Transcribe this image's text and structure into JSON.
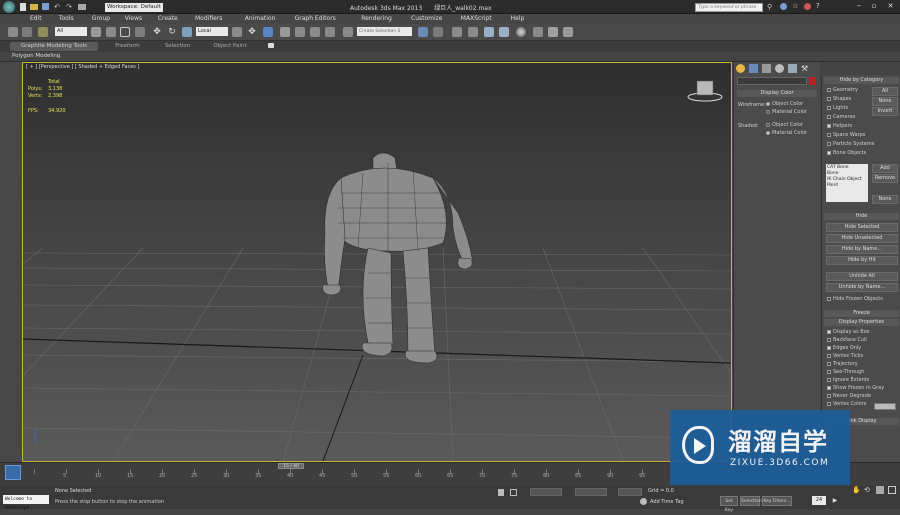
{
  "titlebar": {
    "workspace": "Workspace: Default",
    "app_title": "Autodesk 3ds Max 2013",
    "file": "绿巨人_walk02.max",
    "search_placeholder": "Type a keyword or phrase"
  },
  "menu": [
    "Edit",
    "Tools",
    "Group",
    "Views",
    "Create",
    "Modifiers",
    "Animation",
    "Graph Editors",
    "Rendering",
    "Customize",
    "MAXScript",
    "Help"
  ],
  "toolbar": {
    "selection_filter": "All",
    "ref_coord": "Local",
    "named_selection": "Create Selection S"
  },
  "ribbon": {
    "tabs": [
      "Graphite Modeling Tools",
      "Freeform",
      "Selection",
      "Object Paint"
    ],
    "panel": "Polygon Modeling"
  },
  "viewport": {
    "label": "[ + ] [Perspective ] [ Shaded + Edged Faces ]",
    "stats_header": "Total",
    "polys_label": "Polys:",
    "polys": "3,138",
    "verts_label": "Verts:",
    "verts": "2,398",
    "fps_label": "FPS:",
    "fps": "34.920"
  },
  "display_color": {
    "title": "Display Color",
    "wireframe_label": "Wireframe:",
    "shaded_label": "Shaded:",
    "object_color": "Object Color",
    "material_color": "Material Color"
  },
  "hide_by_category": {
    "title": "Hide by Category",
    "items": [
      "Geometry",
      "Shapes",
      "Lights",
      "Cameras",
      "Helpers",
      "Space Warps",
      "Particle Systems",
      "Bone Objects"
    ],
    "checked": [
      false,
      false,
      false,
      false,
      true,
      false,
      false,
      true
    ],
    "buttons": [
      "All",
      "None",
      "Invert"
    ],
    "list": [
      "CAT Bone",
      "Bone",
      "IK Chain Object",
      "Point"
    ],
    "list_buttons": [
      "Add",
      "Remove",
      "None"
    ]
  },
  "hide": {
    "title": "Hide",
    "buttons": [
      "Hide Selected",
      "Hide Unselected",
      "Hide by Name...",
      "Hide by Hit",
      "Unhide All",
      "Unhide by Name..."
    ],
    "frozen": "Hide Frozen Objects"
  },
  "freeze": {
    "title": "Freeze"
  },
  "display_properties": {
    "title": "Display Properties",
    "items": [
      "Display as Box",
      "Backface Cull",
      "Edges Only",
      "Vertex Ticks",
      "Trajectory",
      "See-Through",
      "Ignore Extents",
      "Show Frozen in Gray",
      "Never Degrade",
      "Vertex Colors"
    ],
    "checked": [
      true,
      false,
      true,
      false,
      false,
      false,
      false,
      true,
      false,
      false
    ]
  },
  "link_display": {
    "title": "Link Display"
  },
  "timeline": {
    "frame": "15 / 40",
    "ticks": [
      "0",
      "5",
      "10",
      "15",
      "20",
      "25",
      "30",
      "35",
      "40",
      "45",
      "50",
      "55",
      "60",
      "65",
      "70",
      "75",
      "80",
      "85",
      "90",
      "95",
      "100"
    ],
    "ticks_shown": [
      "5",
      "10",
      "15",
      "20",
      "25",
      "30",
      "35",
      "40",
      "45",
      "50",
      "55",
      "60",
      "65",
      "70",
      "75",
      "80",
      "85",
      "90",
      "95"
    ]
  },
  "status": {
    "maxscript": "Welcome to MAXScript",
    "selection": "None Selected",
    "prompt": "Press the stop button to stop the animation",
    "add_time_tag": "Add Time Tag",
    "set_key": "Set Key",
    "key_filters": "Key Filters...",
    "grid": "Grid = 0.0",
    "selected": "Selection",
    "frame_value": "24"
  },
  "watermark": {
    "brand": "溜溜自学",
    "url": "ZIXUE.3D66.COM"
  },
  "colors": {
    "viewport_border": "#c9b33c",
    "stats_text": "#e6e25a",
    "watermark_bg": "#1d5e9a"
  }
}
